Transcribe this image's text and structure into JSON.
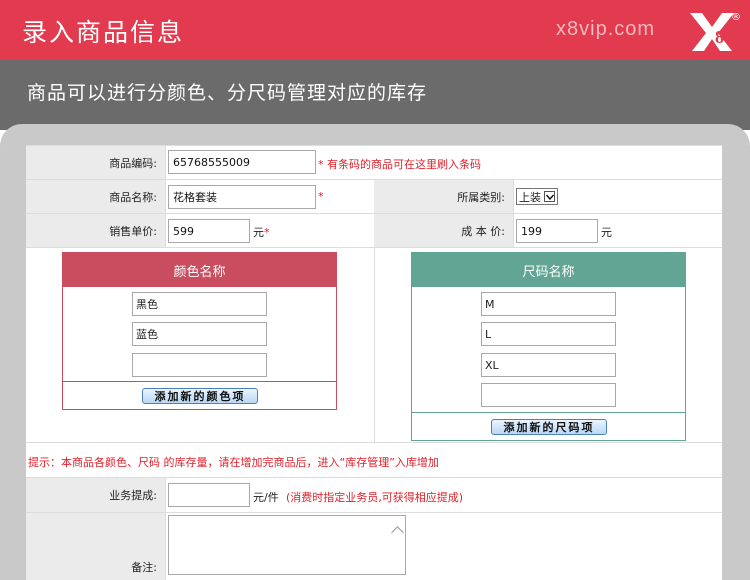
{
  "banner": {
    "title": "录入商品信息",
    "domain": "x8vip.com",
    "logo_text": "X8",
    "logo_mark": "®"
  },
  "subtitle": "商品可以进行分颜色、分尺码管理对应的库存",
  "form": {
    "code": {
      "label": "商品编码:",
      "value": "65768555009",
      "hint": "* 有条码的商品可在这里刷入条码"
    },
    "name": {
      "label": "商品名称:",
      "value": "花格套装",
      "required": "*"
    },
    "category": {
      "label": "所属类别:",
      "selected": "上装"
    },
    "price": {
      "label": "销售单价:",
      "value": "599",
      "unit": "元",
      "required": "*"
    },
    "cost": {
      "label": "成 本 价:",
      "value": "199",
      "unit": "元"
    },
    "colors": {
      "header": "颜色名称",
      "items": [
        "黑色",
        "蓝色",
        ""
      ],
      "add_label": "添加新的颜色项"
    },
    "sizes": {
      "header": "尺码名称",
      "items": [
        "M",
        "L",
        "XL",
        ""
      ],
      "add_label": "添加新的尺码项"
    },
    "tip": "提示：本商品各颜色、尺码 的库存量，请在增加完商品后，进入“库存管理”入库增加",
    "commission": {
      "label": "业务提成:",
      "value": "",
      "unit": "元/件",
      "hint": "(消费时指定业务员,可获得相应提成)"
    },
    "remark": {
      "label": "备注:",
      "value": ""
    }
  },
  "colors": {
    "banner_red": "#e23a4f",
    "band_grey": "#6b6b6b",
    "color_panel": "#c94d5e",
    "size_panel": "#62a595"
  }
}
